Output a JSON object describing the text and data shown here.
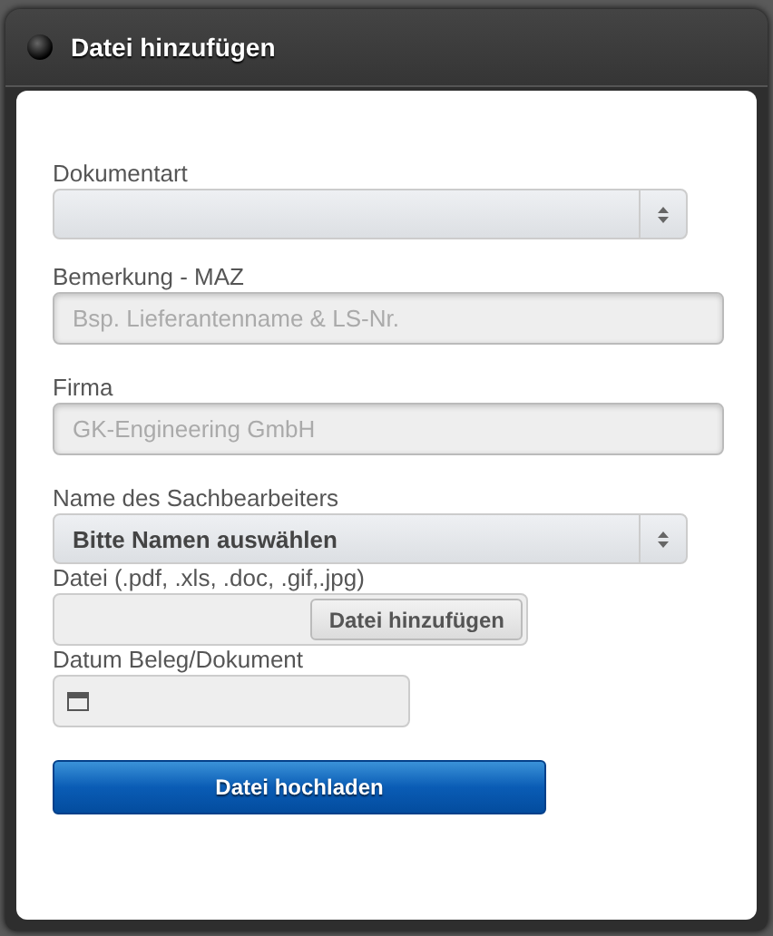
{
  "dialog": {
    "title": "Datei hinzufügen"
  },
  "fields": [
    {
      "kind": "select",
      "label": "Dokumentart"
    },
    {
      "kind": "text",
      "label": "Bemerkung - MAZ",
      "placeholder": "Bsp. Lieferantenname & LS-Nr."
    },
    {
      "kind": "text",
      "label": "Firma",
      "placeholder": "GK-Engineering GmbH"
    },
    {
      "kind": "select",
      "label": "Name des Sachbearbeiters",
      "value": "Bitte Namen auswählen"
    },
    {
      "kind": "file",
      "label": "Datei (.pdf, .xls, .doc, .gif,.jpg)",
      "button": "Datei hinzufügen"
    },
    {
      "kind": "date",
      "label": "Datum Beleg/Dokument"
    }
  ],
  "submit": "Datei hochladen"
}
